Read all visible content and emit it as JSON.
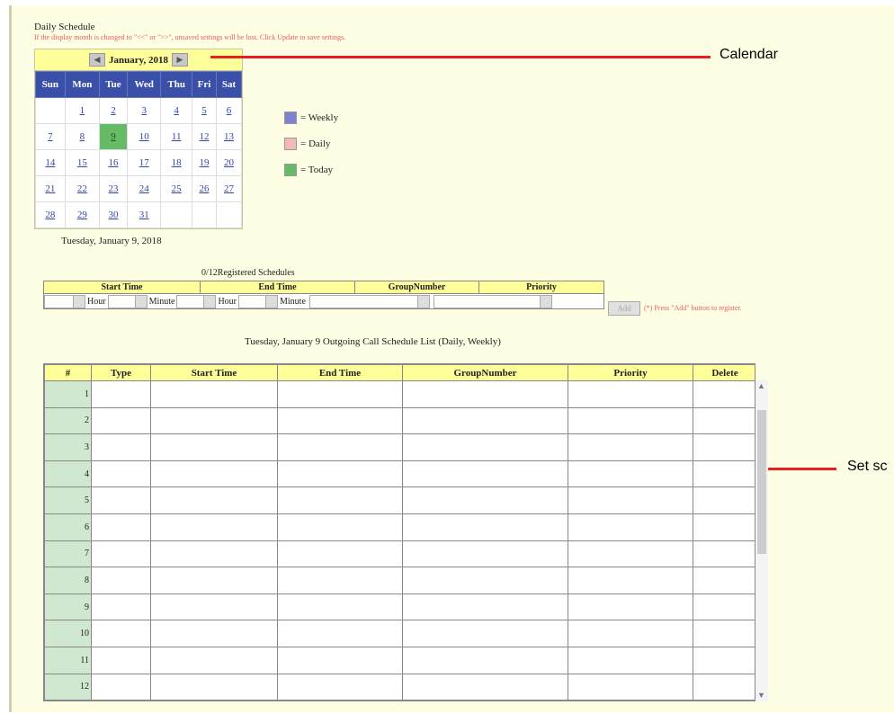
{
  "page": {
    "title": "Daily Schedule",
    "warning": "If the display month is changed to \"<<\" or \">>\", unsaved settings will be lost. Click Update to save settings."
  },
  "calendar": {
    "month_label": "January, 2018",
    "prev_icon": "prev-month-icon",
    "next_icon": "next-month-icon",
    "weekdays": [
      "Sun",
      "Mon",
      "Tue",
      "Wed",
      "Thu",
      "Fri",
      "Sat"
    ],
    "weeks": [
      [
        "",
        "1",
        "2",
        "3",
        "4",
        "5",
        "6"
      ],
      [
        "7",
        "8",
        "9",
        "10",
        "11",
        "12",
        "13"
      ],
      [
        "14",
        "15",
        "16",
        "17",
        "18",
        "19",
        "20"
      ],
      [
        "21",
        "22",
        "23",
        "24",
        "25",
        "26",
        "27"
      ],
      [
        "28",
        "29",
        "30",
        "31",
        "",
        "",
        ""
      ]
    ],
    "today": "9",
    "selected_date": "Tuesday, January 9, 2018"
  },
  "legend": [
    {
      "label": "= Weekly",
      "color": "#8080d0"
    },
    {
      "label": "= Daily",
      "color": "#f4b8b8"
    },
    {
      "label": "= Today",
      "color": "#66bb66"
    }
  ],
  "callouts": {
    "calendar": "Calendar",
    "set": "Set sc"
  },
  "form": {
    "registered": "0/12Registered Schedules",
    "headers": [
      "Start Time",
      "End Time",
      "GroupNumber",
      "Priority"
    ],
    "hour_label": "Hour",
    "minute_label": "Minute",
    "add_label": "Add",
    "add_hint": "(*) Press \"Add\" button to register."
  },
  "list": {
    "title": "Tuesday, January 9    Outgoing Call Schedule List (Daily, Weekly)",
    "headers": [
      "#",
      "Type",
      "Start Time",
      "End Time",
      "GroupNumber",
      "Priority",
      "Delete"
    ],
    "rows": [
      "1",
      "2",
      "3",
      "4",
      "5",
      "6",
      "7",
      "8",
      "9",
      "10",
      "11",
      "12"
    ]
  },
  "colors": {
    "background": "#fefee4",
    "header_yellow": "#ffff99",
    "calendar_header": "#3a4fa8",
    "callout_red": "#e82020"
  }
}
